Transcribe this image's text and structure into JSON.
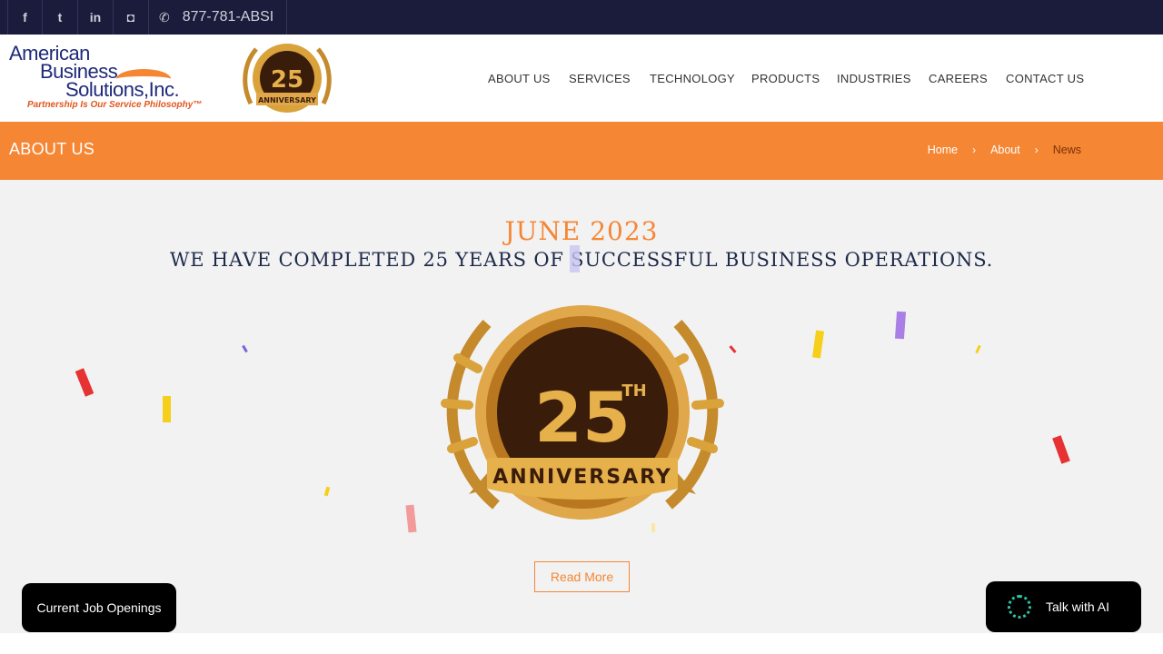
{
  "topbar": {
    "social": [
      {
        "name": "facebook-icon",
        "glyph": "f"
      },
      {
        "name": "twitter-icon",
        "glyph": "t"
      },
      {
        "name": "linkedin-icon",
        "glyph": "in"
      },
      {
        "name": "instagram-icon",
        "glyph": "◘"
      }
    ],
    "phone_icon": "✆",
    "phone": "877-781-ABSI"
  },
  "logo": {
    "line1": "American",
    "line2": "Business",
    "line3": "Solutions,Inc.",
    "tagline": "Partnership Is Our Service Philosophy™"
  },
  "badge": {
    "number": "25",
    "suffix": "TH",
    "ribbon": "ANNIVERSARY"
  },
  "nav": [
    "ABOUT US",
    "SERVICES",
    "TECHNOLOGY",
    "PRODUCTS",
    "INDUSTRIES",
    "CAREERS",
    "CONTACT US"
  ],
  "banner": {
    "title": "ABOUT US",
    "crumbs": [
      "Home",
      "About",
      "News"
    ],
    "sep": "›"
  },
  "main": {
    "date": "JUNE 2023",
    "headline": "WE HAVE COMPLETED 25 YEARS OF SUCCESSFUL BUSINESS OPERATIONS.",
    "read_more": "Read More"
  },
  "floating": {
    "jobs": "Current Job Openings",
    "ai": "Talk with AI"
  },
  "colors": {
    "accent": "#f58634",
    "topbar": "#1b1b3b",
    "navy": "#1e2a4a",
    "gold": "#d9a23b"
  }
}
